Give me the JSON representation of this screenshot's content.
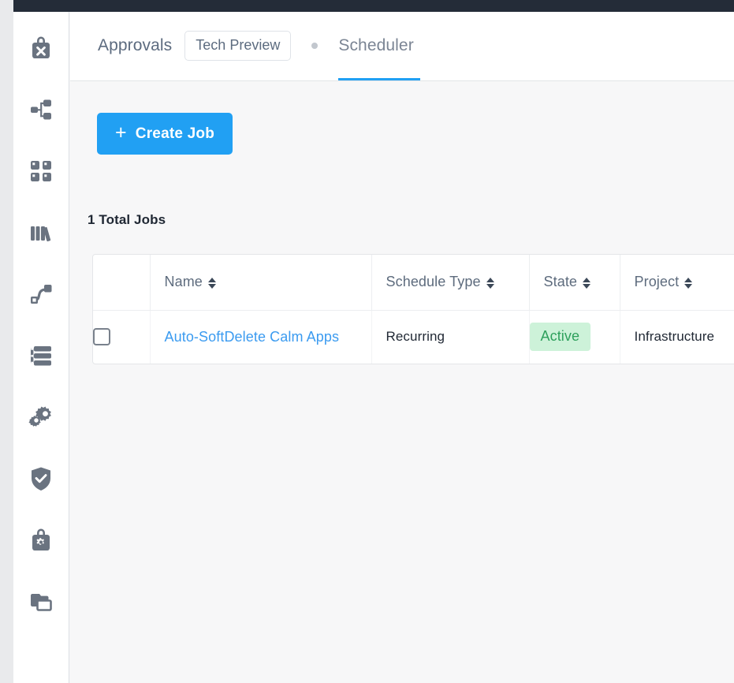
{
  "window": {
    "topbar_color": "#242c38",
    "accent_color": "#21a0f3",
    "content_bg": "#f7f7f8"
  },
  "sidebar": {
    "items": [
      {
        "name": "marketplace-icon",
        "label": "Marketplace"
      },
      {
        "name": "sitemap-icon",
        "label": "Blueprints"
      },
      {
        "name": "apps-grid-icon",
        "label": "Applications"
      },
      {
        "name": "library-icon",
        "label": "Library"
      },
      {
        "name": "flow-icon",
        "label": "Runbooks"
      },
      {
        "name": "tasks-list-icon",
        "label": "Tasks"
      },
      {
        "name": "gears-icon",
        "label": "Settings"
      },
      {
        "name": "shield-check-icon",
        "label": "Policies"
      },
      {
        "name": "lock-gear-icon",
        "label": "Roles"
      },
      {
        "name": "clone-icon",
        "label": "Clone"
      }
    ]
  },
  "tabs": {
    "approvals_label": "Approvals",
    "tech_preview_label": "Tech Preview",
    "scheduler_label": "Scheduler",
    "active_tab": "Scheduler"
  },
  "main": {
    "create_job_label": "Create Job",
    "create_job_plus": "+",
    "total_jobs_label": "1 Total Jobs"
  },
  "table": {
    "columns": [
      {
        "key": "checkbox",
        "label": ""
      },
      {
        "key": "name",
        "label": "Name"
      },
      {
        "key": "schedule_type",
        "label": "Schedule Type"
      },
      {
        "key": "state",
        "label": "State"
      },
      {
        "key": "project",
        "label": "Project"
      }
    ],
    "rows": [
      {
        "checked": false,
        "name": "Auto-SoftDelete Calm Apps",
        "schedule_type": "Recurring",
        "state": "Active",
        "state_color": "#2ea05c",
        "state_bg": "#cdf2d9",
        "project": "Infrastructure"
      }
    ]
  }
}
